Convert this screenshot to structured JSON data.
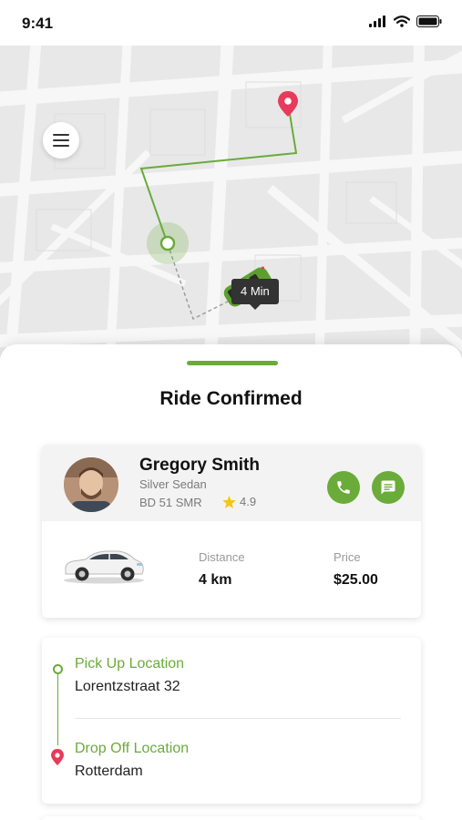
{
  "status_bar": {
    "time": "9:41"
  },
  "map": {
    "eta": "4 Min",
    "route_color": "#6aab3a",
    "destination_color": "#e83a5a",
    "menu_icon": "hamburger-icon"
  },
  "sheet": {
    "title": "Ride Confirmed"
  },
  "driver": {
    "name": "Gregory Smith",
    "vehicle": "Silver Sedan",
    "plate": "BD 51 SMR",
    "rating": "4.9",
    "call_icon": "phone-icon",
    "message_icon": "chat-icon"
  },
  "trip": {
    "distance_label": "Distance",
    "distance_value": "4 km",
    "price_label": "Price",
    "price_value": "$25.00"
  },
  "locations": {
    "pickup_label": "Pick Up Location",
    "pickup_address": "Lorentzstraat 32",
    "dropoff_label": "Drop Off Location",
    "dropoff_address": "Rotterdam"
  },
  "colors": {
    "accent": "#6aab3a",
    "pin": "#e83a5a",
    "star": "#f5c518"
  }
}
